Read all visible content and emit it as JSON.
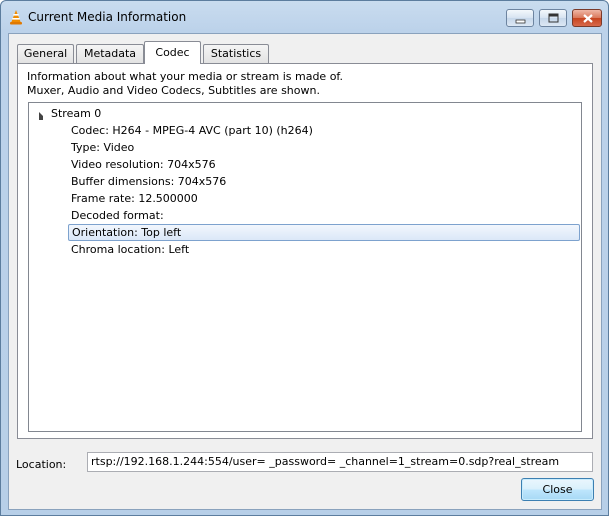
{
  "window": {
    "title": "Current Media Information"
  },
  "icons": {
    "app": "vlc-cone-icon",
    "minimize": "minimize-icon",
    "maximize": "maximize-icon",
    "close": "close-icon"
  },
  "colors": {
    "accent_orange": "#f08c00",
    "selection_border": "#7da2ce",
    "close_red": "#c7441f"
  },
  "tabs": [
    {
      "label": "General",
      "active": false
    },
    {
      "label": "Metadata",
      "active": false
    },
    {
      "label": "Codec",
      "active": true
    },
    {
      "label": "Statistics",
      "active": false
    }
  ],
  "codec": {
    "description_line1": "Information about what your media or stream is made of.",
    "description_line2": "Muxer, Audio and Video Codecs, Subtitles are shown.",
    "stream": {
      "label": "Stream 0",
      "items": [
        "Codec: H264 - MPEG-4 AVC (part 10) (h264)",
        "Type: Video",
        "Video resolution: 704x576",
        "Buffer dimensions: 704x576",
        "Frame rate: 12.500000",
        "Decoded format:",
        "Orientation: Top left",
        "Chroma location: Left"
      ],
      "selected_index": 6
    }
  },
  "location": {
    "label": "Location:",
    "value": "rtsp://192.168.1.244:554/user=       _password=            _channel=1_stream=0.sdp?real_stream"
  },
  "buttons": {
    "close": "Close"
  }
}
